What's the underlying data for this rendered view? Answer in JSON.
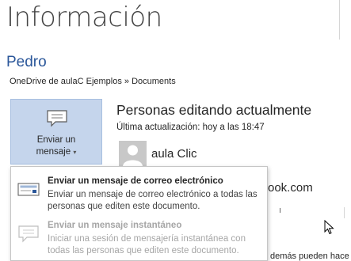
{
  "header": {
    "title": "Información"
  },
  "document": {
    "name": "Pedro",
    "path": "OneDrive de aulaC Ejemplos » Documents"
  },
  "send_button": {
    "label_line1": "Enviar un",
    "label_line2": "mensaje",
    "caret": "▾",
    "icon": "speech-bubble-icon"
  },
  "people": {
    "title": "Personas editando actualmente",
    "last_update": "Última actualización: hoy a las 18:47",
    "users": [
      {
        "name": "aula Clic",
        "icon": "avatar-placeholder-icon"
      }
    ]
  },
  "background_fragments": {
    "email_fragment": "ook.com",
    "bottom_fragment": "demás pueden hace"
  },
  "dropdown_menu": {
    "items": [
      {
        "title": "Enviar un mensaje de correo electrónico",
        "title_underlined_letter": "c",
        "description": "Enviar un mensaje de correo electrónico a todas las personas que editen este documento.",
        "enabled": true,
        "icon": "email-icon"
      },
      {
        "title": "Enviar un mensaje instantáneo",
        "title_underlined_letter": "i",
        "description": "Iniciar una sesión de mensajería instantánea con todas las personas que editen este documento.",
        "enabled": false,
        "icon": "instant-message-icon"
      }
    ]
  },
  "colors": {
    "title_blue": "#2b579a",
    "button_bg": "#c5d5ec",
    "button_border": "#a8bfe0",
    "disabled_text": "#a6a6a6"
  }
}
